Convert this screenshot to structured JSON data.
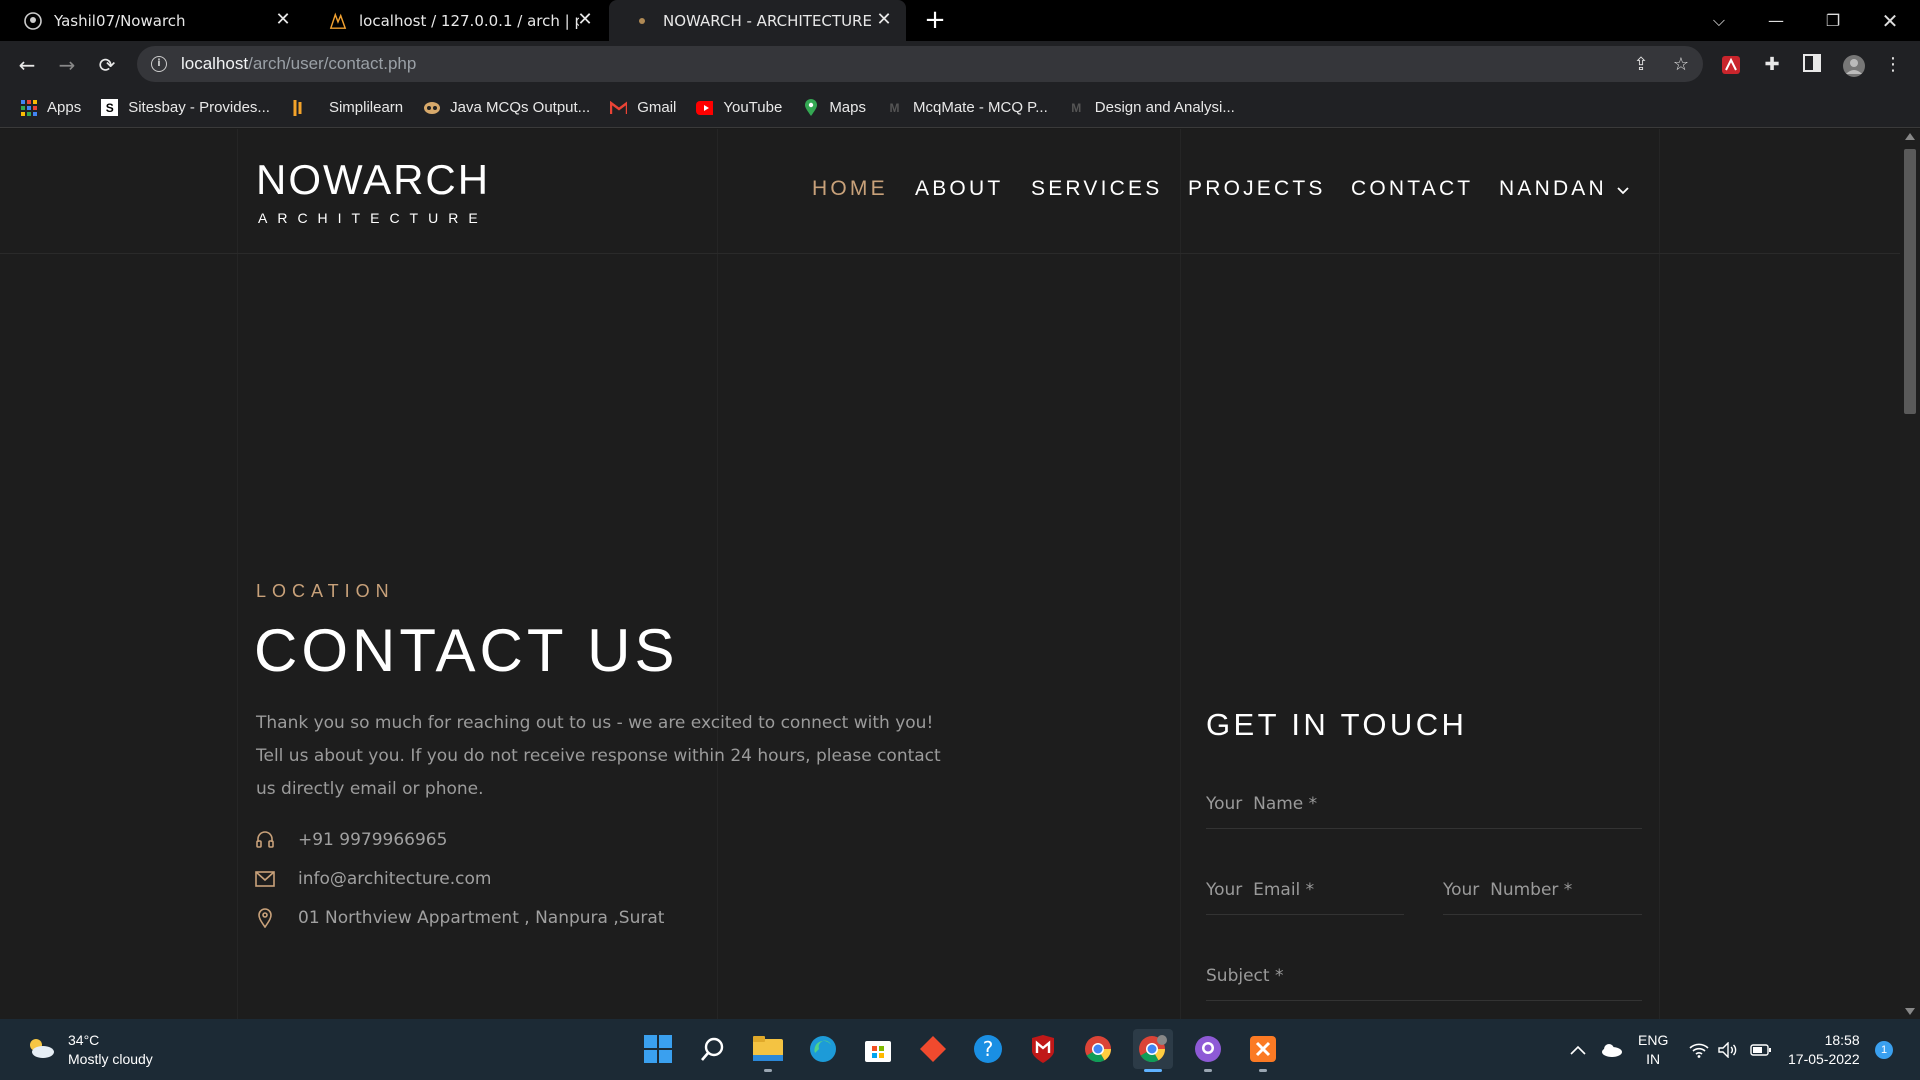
{
  "browser": {
    "tabs": [
      {
        "title": "Yashil07/Nowarch",
        "icon": "github-icon"
      },
      {
        "title": "localhost / 127.0.0.1 / arch | phpMyAdmin",
        "icon": "phpmyadmin-icon"
      },
      {
        "title": "NOWARCH - ARCHITECTURE",
        "icon": "loading-dot-icon"
      }
    ],
    "url_host": "localhost",
    "url_path": "/arch/user/contact.php",
    "bookmarks": [
      {
        "label": "Apps",
        "icon": "apps-grid-icon"
      },
      {
        "label": "Sitesbay - Provides...",
        "icon": "sitesbay-icon"
      },
      {
        "label": "Simplilearn",
        "icon": "simplilearn-icon"
      },
      {
        "label": "Java MCQs Output...",
        "icon": "java-icon"
      },
      {
        "label": "Gmail",
        "icon": "gmail-icon"
      },
      {
        "label": "YouTube",
        "icon": "youtube-icon"
      },
      {
        "label": "Maps",
        "icon": "maps-icon"
      },
      {
        "label": "McqMate - MCQ P...",
        "icon": "mcqmate-icon"
      },
      {
        "label": "Design and Analysi...",
        "icon": "mcqmate-icon"
      }
    ]
  },
  "site": {
    "logo_main": "NOWARCH",
    "logo_sub": "ARCHITECTURE",
    "nav": [
      {
        "label": "HOME",
        "active": true
      },
      {
        "label": "ABOUT",
        "active": false
      },
      {
        "label": "SERVICES",
        "active": false
      },
      {
        "label": "PROJECTS",
        "active": false
      },
      {
        "label": "CONTACT",
        "active": false
      },
      {
        "label": "NANDAN",
        "active": false
      }
    ],
    "accent_color": "#c8a17a"
  },
  "contact": {
    "eyebrow": "LOCATION",
    "title": "CONTACT US",
    "intro": "Thank you so much for reaching out to us - we are excited to connect with you! Tell us about you.  If you do not receive response within 24 hours, please contact us directly email or phone.",
    "phone": "+91 9979966965",
    "email": "info@architecture.com",
    "address": "01  Northview Appartment ,  Nanpura ,Surat"
  },
  "form": {
    "title": "GET IN TOUCH",
    "name_placeholder": "Your  Name *",
    "email_placeholder": "Your  Email *",
    "number_placeholder": "Your  Number *",
    "subject_placeholder": "Subject *"
  },
  "taskbar": {
    "temperature": "34°C",
    "weather": "Mostly cloudy",
    "lang_1": "ENG",
    "lang_2": "IN",
    "time": "18:58",
    "date": "17-05-2022",
    "notification_count": "1"
  }
}
